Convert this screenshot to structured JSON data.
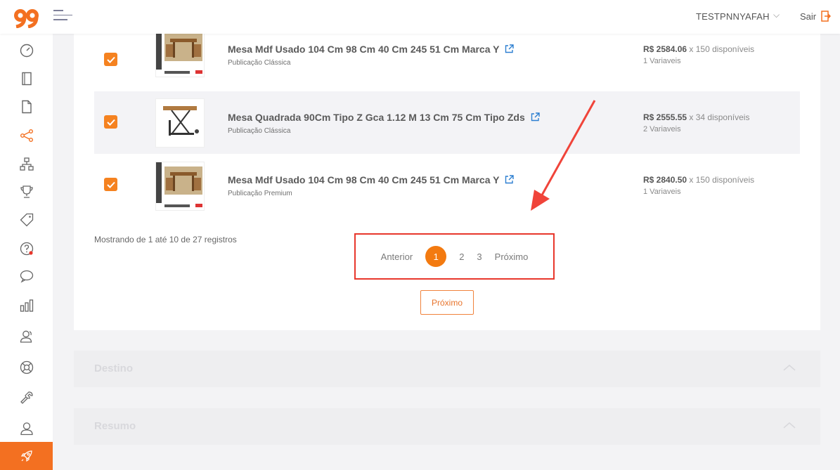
{
  "header": {
    "username": "TESTPNNYAFAH",
    "logout_label": "Sair"
  },
  "sidebar": {
    "icons": [
      "speedometer-icon",
      "notebook-icon",
      "file-icon",
      "share-icon",
      "sitemap-icon",
      "trophy-icon",
      "tag-icon",
      "help-icon",
      "chat-icon",
      "bar-chart-icon",
      "user-group-icon",
      "lifebuoy-icon",
      "wrench-icon",
      "user-icon",
      "rocket-icon"
    ]
  },
  "products": [
    {
      "title": "Mesa Mdf Usado 104 Cm 98 Cm 40 Cm 245 51 Cm Marca Y",
      "type": "Publicação Clássica",
      "price": "R$ 2584.06",
      "availability": "x 150 disponíveis",
      "variants": "1 Variaveis"
    },
    {
      "title": "Mesa Quadrada 90Cm Tipo Z Gca 1.12 M 13 Cm 75 Cm Tipo Zds",
      "type": "Publicação Clássica",
      "price": "R$ 2555.55",
      "availability": "x 34 disponíveis",
      "variants": "2 Variaveis"
    },
    {
      "title": "Mesa Mdf Usado 104 Cm 98 Cm 40 Cm 245 51 Cm Marca Y",
      "type": "Publicação Premium",
      "price": "R$ 2840.50",
      "availability": "x 150 disponíveis",
      "variants": "1 Variaveis"
    }
  ],
  "records_text": "Mostrando de 1 até 10 de 27 registros",
  "pagination": {
    "prev_label": "Anterior",
    "pages": [
      "1",
      "2",
      "3"
    ],
    "current": "1",
    "next_label": "Próximo"
  },
  "next_button_label": "Próximo",
  "sections": {
    "destino": "Destino",
    "resumo": "Resumo"
  },
  "colors": {
    "accent": "#f37021",
    "highlight_border": "#e8372c"
  }
}
